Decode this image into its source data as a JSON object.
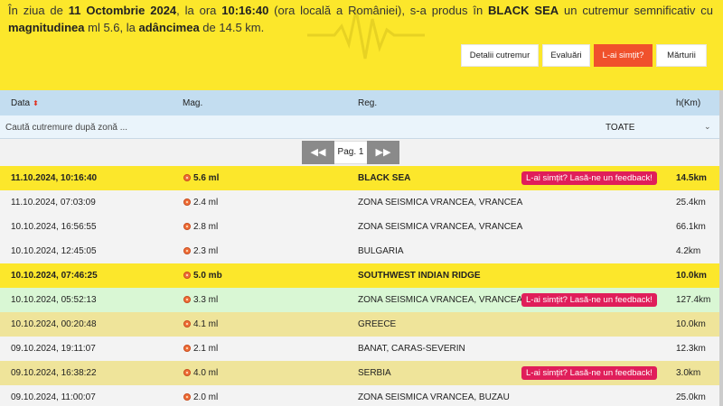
{
  "banner": {
    "prefix": "În ziua de ",
    "date": "11 Octombrie 2024",
    "mid1": ", la ora ",
    "time": "10:16:40",
    "mid2": " (ora locală a României), s-a produs în ",
    "region": "BLACK SEA",
    "mid3": " un cutremur ",
    "severity": "semnificativ",
    "mid4": " cu ",
    "mag_label": "magnitudinea",
    "mid5": " ml 5.6, la ",
    "depth_label": "adâncimea",
    "suffix": " de 14.5 km."
  },
  "tabs": [
    "Detalii cutremur",
    "Evaluări",
    "L-ai simțit?",
    "Mărturii"
  ],
  "colors": {
    "banner": "#fce72b",
    "active_tab": "#f0512c",
    "feedback": "#e01e5a",
    "header": "#c3ddf0",
    "green_row": "#d9f7d4",
    "khaki_row": "#efe49a"
  },
  "table": {
    "headers": {
      "date": "Data",
      "mag": "Mag.",
      "region": "Reg.",
      "depth": "h(Km)"
    },
    "sort_icon": "sort-updown-icon",
    "search_placeholder": "Caută cutremure după zonă ...",
    "filter_value": "TOATE",
    "pager_label": "Pag. 1",
    "prev_icon": "double-left-arrow-icon",
    "next_icon": "double-right-arrow-icon",
    "feedback_label": "L-ai simțit? Lasă-ne un feedback!",
    "rows": [
      {
        "date": "11.10.2024, 10:16:40",
        "mag": "5.6 ml",
        "region": "BLACK SEA",
        "depth": "14.5km"
      },
      {
        "date": "11.10.2024, 07:03:09",
        "mag": "2.4 ml",
        "region": "ZONA SEISMICA VRANCEA, VRANCEA",
        "depth": "25.4km"
      },
      {
        "date": "10.10.2024, 16:56:55",
        "mag": "2.8 ml",
        "region": "ZONA SEISMICA VRANCEA, VRANCEA",
        "depth": "66.1km"
      },
      {
        "date": "10.10.2024, 12:45:05",
        "mag": "2.3 ml",
        "region": "BULGARIA",
        "depth": "4.2km"
      },
      {
        "date": "10.10.2024, 07:46:25",
        "mag": "5.0 mb",
        "region": "SOUTHWEST INDIAN RIDGE",
        "depth": "10.0km"
      },
      {
        "date": "10.10.2024, 05:52:13",
        "mag": "3.3 ml",
        "region": "ZONA SEISMICA VRANCEA, VRANCEA",
        "depth": "127.4km"
      },
      {
        "date": "10.10.2024, 00:20:48",
        "mag": "4.1 ml",
        "region": "GREECE",
        "depth": "10.0km"
      },
      {
        "date": "09.10.2024, 19:11:07",
        "mag": "2.1 ml",
        "region": "BANAT, CARAS-SEVERIN",
        "depth": "12.3km"
      },
      {
        "date": "09.10.2024, 16:38:22",
        "mag": "4.0 ml",
        "region": "SERBIA",
        "depth": "3.0km"
      },
      {
        "date": "09.10.2024, 11:00:07",
        "mag": "2.0 ml",
        "region": "ZONA SEISMICA VRANCEA, BUZAU",
        "depth": "25.0km"
      }
    ]
  }
}
